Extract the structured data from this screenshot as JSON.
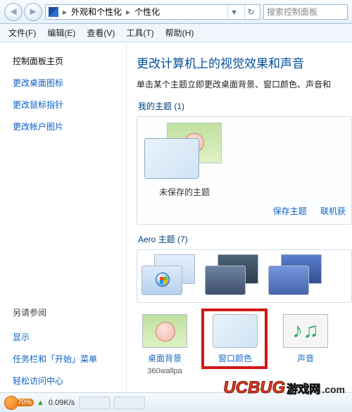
{
  "breadcrumb": {
    "level1": "外观和个性化",
    "level2": "个性化"
  },
  "search": {
    "placeholder": "搜索控制面板"
  },
  "menu": {
    "file": "文件(F)",
    "edit": "编辑(E)",
    "view": "查看(V)",
    "tools": "工具(T)",
    "help": "帮助(H)"
  },
  "sidebar": {
    "home": "控制面板主页",
    "icons": "更改桌面图标",
    "pointers": "更改鼠标指针",
    "account_pic": "更改帐户图片",
    "see_also": "另请参阅",
    "display": "显示",
    "taskbar": "任务栏和「开始」菜单",
    "ease": "轻松访问中心"
  },
  "main": {
    "heading": "更改计算机上的视觉效果和声音",
    "sub": "单击某个主题立即更改桌面背景、窗口颜色、声音和",
    "my_themes_title": "我的主题 (1)",
    "unsaved_theme": "未保存的主题",
    "save_theme": "保存主题",
    "online_themes": "联机获",
    "aero_title": "Aero 主题 (7)"
  },
  "bottom": {
    "wallpaper": "桌面背景",
    "wallpaper_sub": "360wallpa",
    "window_color": "窗口颜色",
    "sound": "声音"
  },
  "taskbar": {
    "zoom": "70%",
    "speed": "0.09K/s"
  },
  "watermark": {
    "brand": "UCBUG",
    "tag": "游戏网",
    "dotcom": ".com"
  }
}
